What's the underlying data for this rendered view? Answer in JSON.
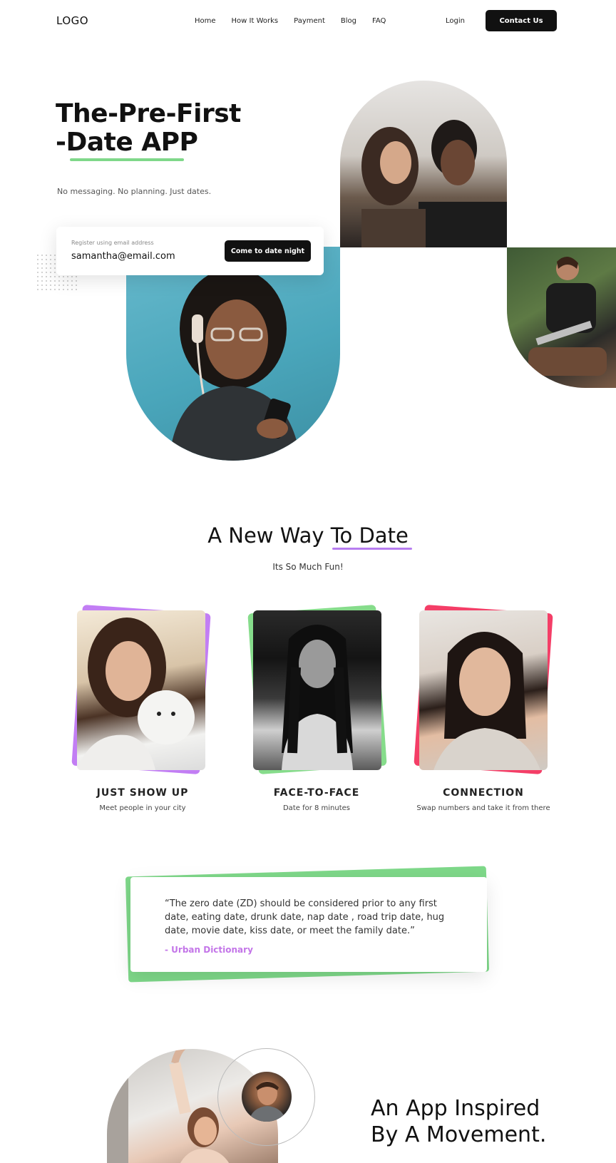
{
  "nav": {
    "logo": "LOGO",
    "links": [
      "Home",
      "How It Works",
      "Payment",
      "Blog",
      "FAQ"
    ],
    "login": "Login",
    "contact": "Contact Us"
  },
  "hero": {
    "title_line1": "The-Pre-First",
    "title_line2": "-Date APP",
    "subtitle": "No messaging. No planning. Just dates.",
    "register": {
      "label": "Register using email address",
      "email": "samantha@email.com",
      "button": "Come to date night"
    }
  },
  "section": {
    "title_part1": "A New Way",
    "title_part2": "To Date",
    "subtitle": "Its So Much Fun!",
    "cards": [
      {
        "title": "JUST SHOW UP",
        "desc": "Meet people in your city",
        "accent": "#c27ef4"
      },
      {
        "title": "FACE-TO-FACE",
        "desc": "Date for 8 minutes",
        "accent": "#86dc8b"
      },
      {
        "title": "CONNECTION",
        "desc": "Swap numbers and take it from there",
        "accent": "#f43e67"
      }
    ]
  },
  "quote": {
    "text": "“The zero date (ZD) should be considered prior to any first date, eating date, drunk date, nap date , road trip date, hug date, movie date, kiss date, or meet the family date.”",
    "source": "- Urban Dictionary"
  },
  "bottom": {
    "title_line1": "An App Inspired",
    "title_line2": "By A Movement."
  },
  "colors": {
    "green": "#7fd88a",
    "purple": "#b77df0",
    "pink": "#f43e67",
    "dark": "#111111"
  }
}
